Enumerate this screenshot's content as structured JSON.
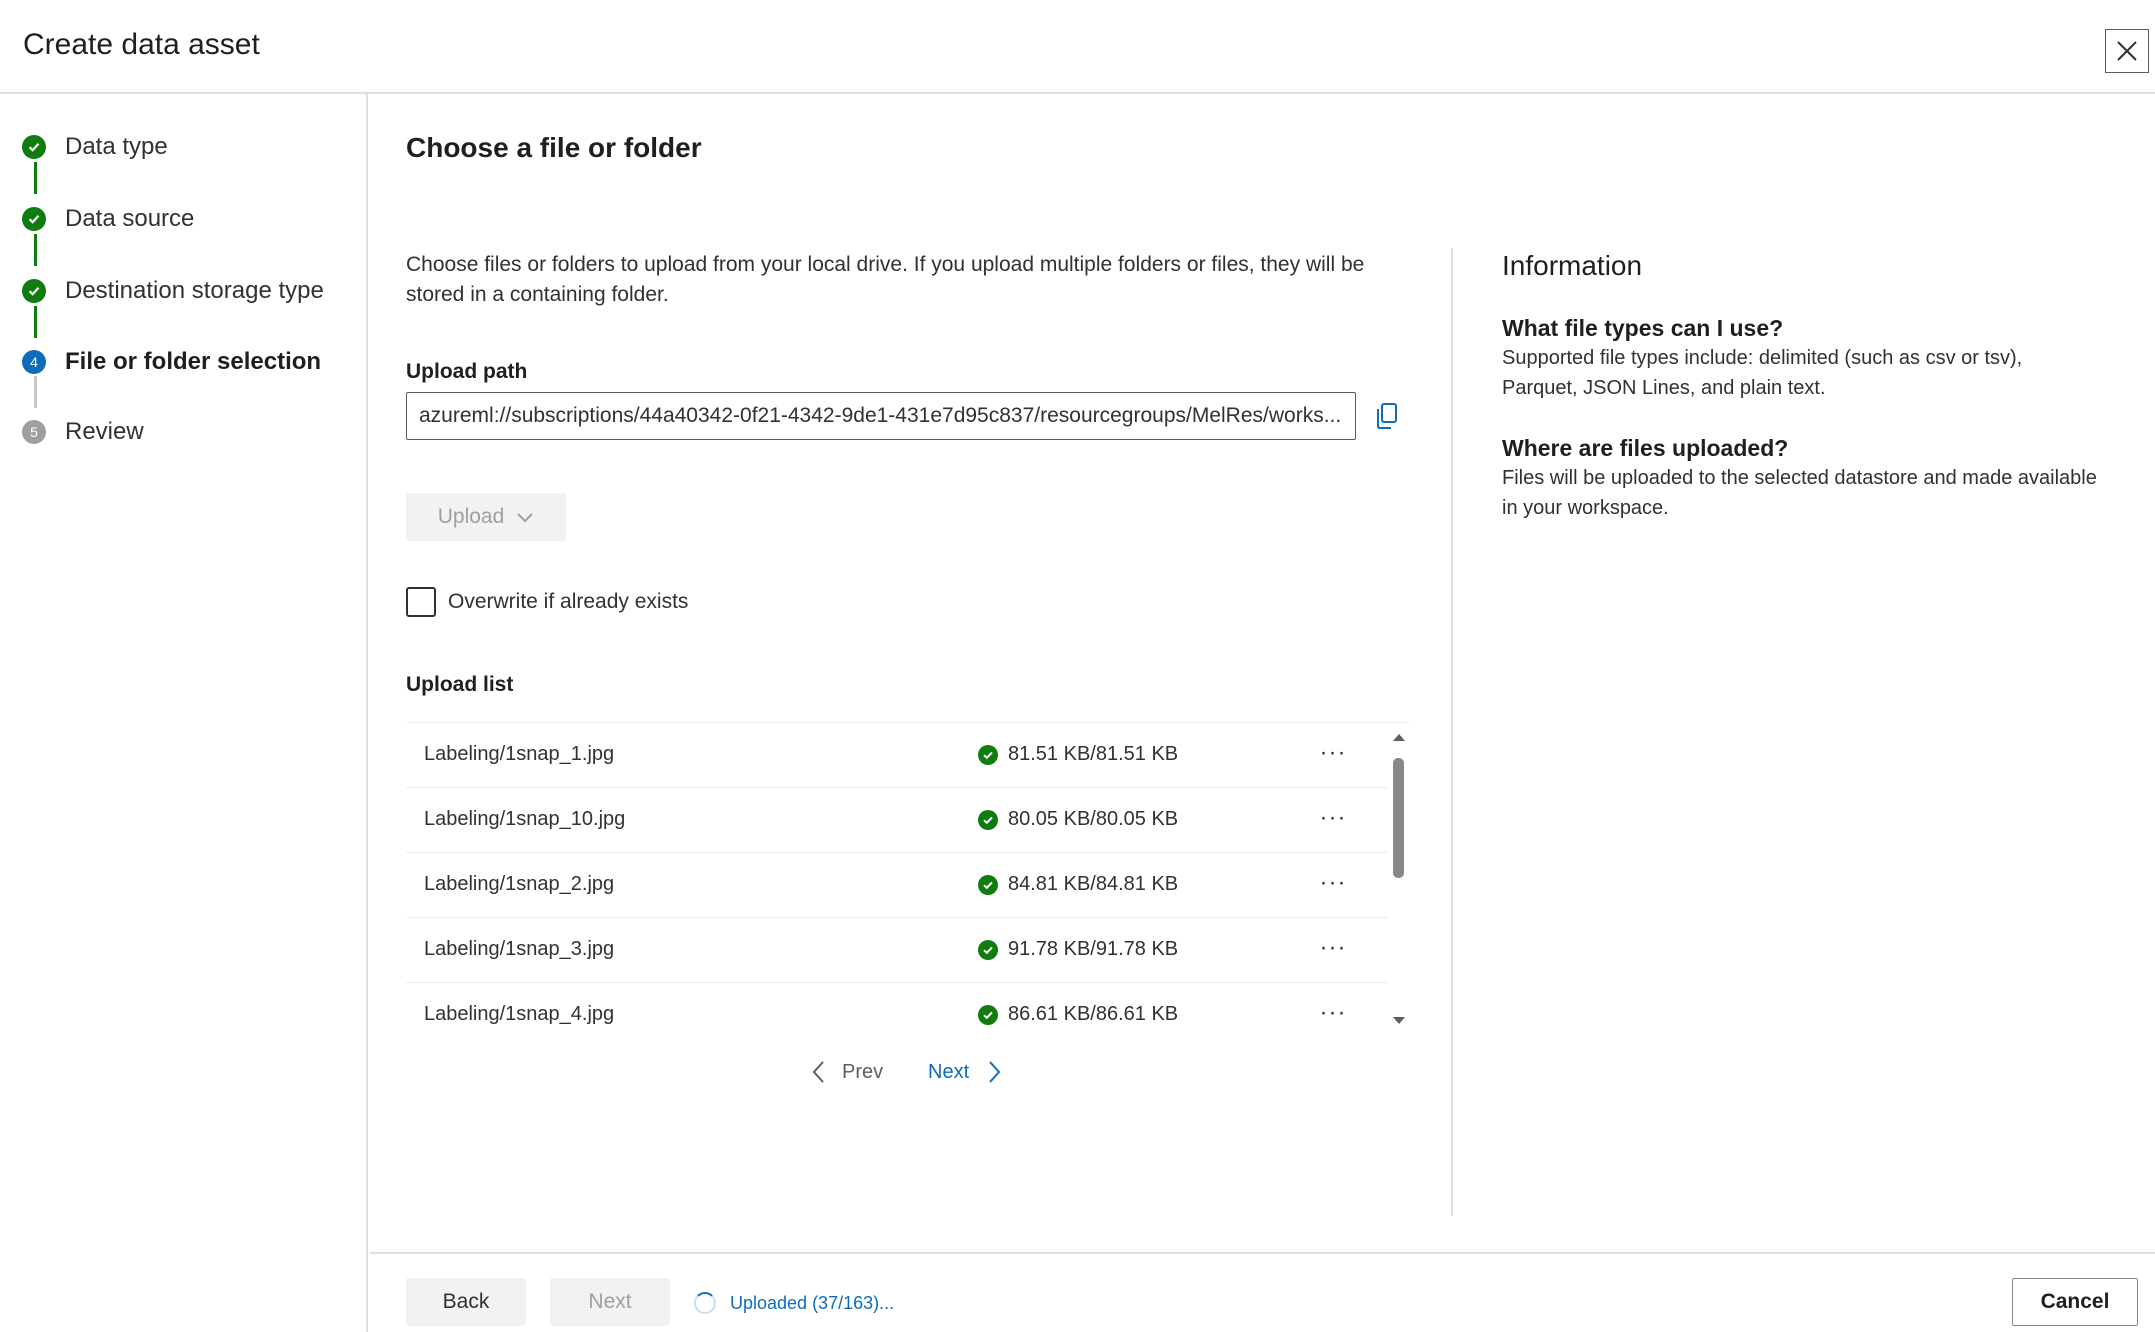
{
  "header": {
    "title": "Create data asset",
    "close_icon": "close-icon"
  },
  "steps": [
    {
      "label": "Data type",
      "state": "done"
    },
    {
      "label": "Data source",
      "state": "done"
    },
    {
      "label": "Destination storage type",
      "state": "done"
    },
    {
      "label": "File or folder selection",
      "state": "current",
      "number": "4"
    },
    {
      "label": "Review",
      "state": "pending",
      "number": "5"
    }
  ],
  "main": {
    "title": "Choose a file or folder",
    "description": "Choose files or folders to upload from your local drive. If you upload multiple folders or files, they will be stored in a containing folder.",
    "upload_path_label": "Upload path",
    "upload_path_value": "azureml://subscriptions/44a40342-0f21-4342-9de1-431e7d95c837/resourcegroups/MelRes/works...",
    "upload_button": "Upload",
    "overwrite_label": "Overwrite if already exists",
    "upload_list_label": "Upload list",
    "files": [
      {
        "name": "Labeling/1snap_1.jpg",
        "size": "81.51 KB/81.51 KB"
      },
      {
        "name": "Labeling/1snap_10.jpg",
        "size": "80.05 KB/80.05 KB"
      },
      {
        "name": "Labeling/1snap_2.jpg",
        "size": "84.81 KB/84.81 KB"
      },
      {
        "name": "Labeling/1snap_3.jpg",
        "size": "91.78 KB/91.78 KB"
      },
      {
        "name": "Labeling/1snap_4.jpg",
        "size": "86.61 KB/86.61 KB"
      }
    ],
    "pager": {
      "prev": "Prev",
      "next": "Next"
    }
  },
  "info": {
    "title": "Information",
    "q1": "What file types can I use?",
    "a1": "Supported file types include: delimited (such as csv or tsv), Parquet, JSON Lines, and plain text.",
    "q2": "Where are files uploaded?",
    "a2": "Files will be uploaded to the selected datastore and made available in your workspace."
  },
  "footer": {
    "back": "Back",
    "next": "Next",
    "status": "Uploaded (37/163)...",
    "cancel": "Cancel"
  },
  "colors": {
    "success": "#107c10",
    "accent": "#0f6cbd",
    "current_step": "#0f6cbd",
    "pending_step": "#a19f9d"
  }
}
